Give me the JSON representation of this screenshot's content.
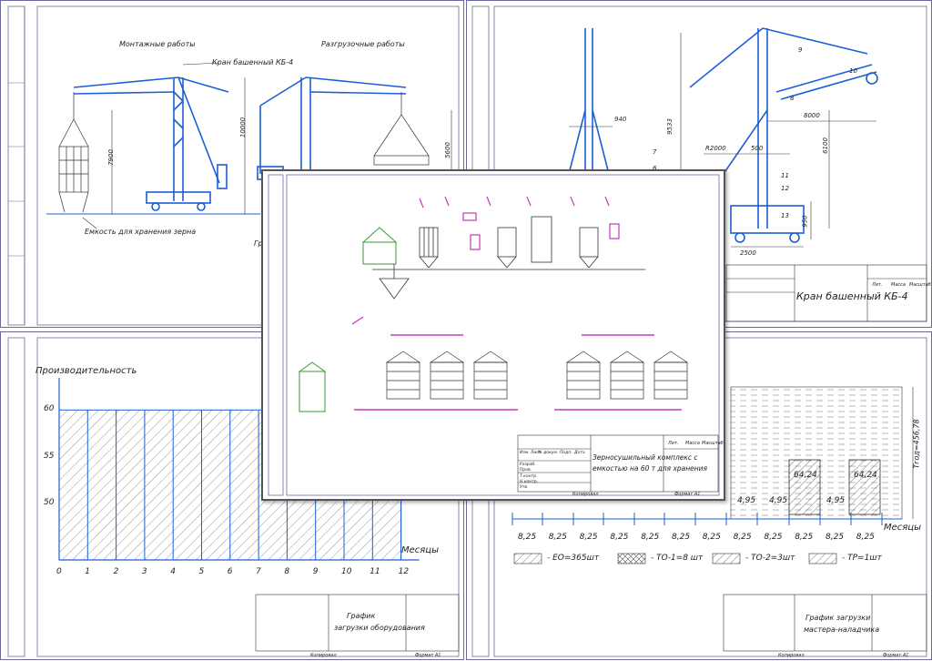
{
  "sheet_tl": {
    "left_caption": "Монтажные работы",
    "right_caption": "Разгрузочные работы",
    "crane_label": "Кран башенный КБ-4",
    "dims": [
      "7900",
      "10000",
      "5600"
    ],
    "container_label": "Емкость для хранения зерна",
    "cut_text": "Гру"
  },
  "sheet_tr": {
    "dims_top": [
      "940",
      "9533",
      "R2000",
      "500",
      "8000",
      "6100",
      "950",
      "2500"
    ],
    "callouts": [
      "9",
      "10",
      "8",
      "7",
      "6",
      "11",
      "12",
      "13"
    ],
    "title": "Кран башенный КБ-4",
    "stamp_heads": [
      "Лит.",
      "Масса",
      "Масштаб"
    ]
  },
  "sheet_bl": {
    "ylabel": "Производительность",
    "yticks": [
      "60",
      "55",
      "50"
    ],
    "xlabel": "Месяцы",
    "xticks": [
      "0",
      "1",
      "2",
      "3",
      "4",
      "5",
      "6",
      "7",
      "8",
      "9",
      "10",
      "11",
      "12"
    ],
    "title_line1": "График",
    "title_line2": "загрузки оборудования",
    "footer_left": "Копировал",
    "footer_right": "Формат  А1"
  },
  "sheet_br": {
    "values_top": [
      "64,24",
      "64,24"
    ],
    "values_mid": [
      "4,95",
      "4,95",
      "4,95"
    ],
    "values_bottom": [
      "8,25",
      "8,25",
      "8,25",
      "8,25",
      "8,25",
      "8,25",
      "8,25",
      "8,25",
      "8,25",
      "8,25",
      "8,25",
      "8,25"
    ],
    "vert_label": "Тгод=456,78",
    "xlabel": "Месяцы",
    "legend": [
      "- ЕО=365шт",
      "- ТО-1=8 шт",
      "- ТО-2=3шт",
      "- ТР=1шт"
    ],
    "title_line1": "График загрузки",
    "title_line2": "мастера-наладчика",
    "footer_left": "Копировал",
    "footer_right": "Формат  А1"
  },
  "sheet_center": {
    "title_line1": "Зерносушильный комплекс с",
    "title_line2": "емкостью на 60 т для хранения",
    "stamp_heads": [
      "Лит.",
      "Масса",
      "Масштаб"
    ],
    "stamp_rows": [
      "Изм. Лист",
      "№ докум.",
      "Подп.",
      "Дата",
      "Разраб.",
      "Пров.",
      "Т.контр.",
      "Н.контр.",
      "Утв."
    ],
    "footer_left": "Копировал",
    "footer_right": "Формат  А1"
  },
  "chart_data": {
    "type": "area",
    "title": "",
    "xlabel": "Месяцы",
    "ylabel": "Производительность",
    "x": [
      0,
      1,
      2,
      3,
      4,
      5,
      6,
      7,
      8,
      9,
      10,
      11,
      12
    ],
    "ylim": [
      45,
      61
    ],
    "categories": [
      "0",
      "1",
      "2",
      "3",
      "4",
      "5",
      "6",
      "7",
      "8",
      "9",
      "10",
      "11",
      "12"
    ]
  },
  "colors": {
    "line": "#1b5fd6",
    "frame": "#6a6aa0",
    "accent_pink": "#c33ab8",
    "accent_green": "#3a9a3a"
  }
}
